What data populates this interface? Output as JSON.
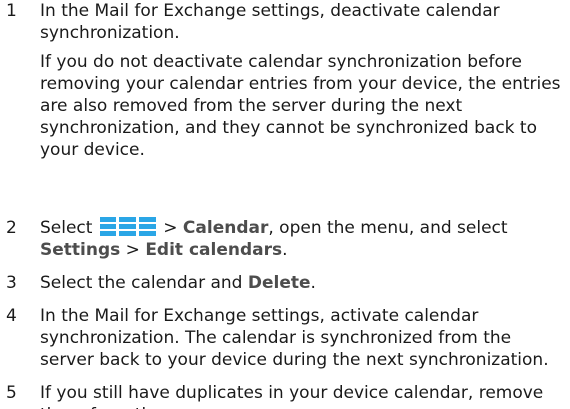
{
  "steps": [
    {
      "number": "1",
      "text": "In the Mail for Exchange settings, deactivate calendar synchronization.",
      "note": "If you do not deactivate calendar synchronization before removing your calendar entries from your device, the entries are also removed from the server during the next synchronization, and they cannot be synchronized back to your device."
    },
    {
      "number": "2",
      "part1": "Select",
      "part2": " > ",
      "link1": "Calendar",
      "part3": ", open the menu, and select",
      "link2": "Settings",
      "part4": " > ",
      "link3": "Edit calendars",
      "part5": ".",
      "icon": "menu-grid-icon"
    },
    {
      "number": "3",
      "part1": "Select the calendar and ",
      "link1": "Delete",
      "part2": "."
    },
    {
      "number": "4",
      "text": "In the Mail for Exchange settings, activate calendar synchronization. The calendar is synchronized from the server back to your device during the next synchronization."
    },
    {
      "number": "5",
      "text": "If you still have duplicates in your device calendar, remove them from the server."
    }
  ],
  "colors": {
    "text": "#1a1a1a",
    "link": "#4d4d4d",
    "icon": "#2aa6e6"
  }
}
